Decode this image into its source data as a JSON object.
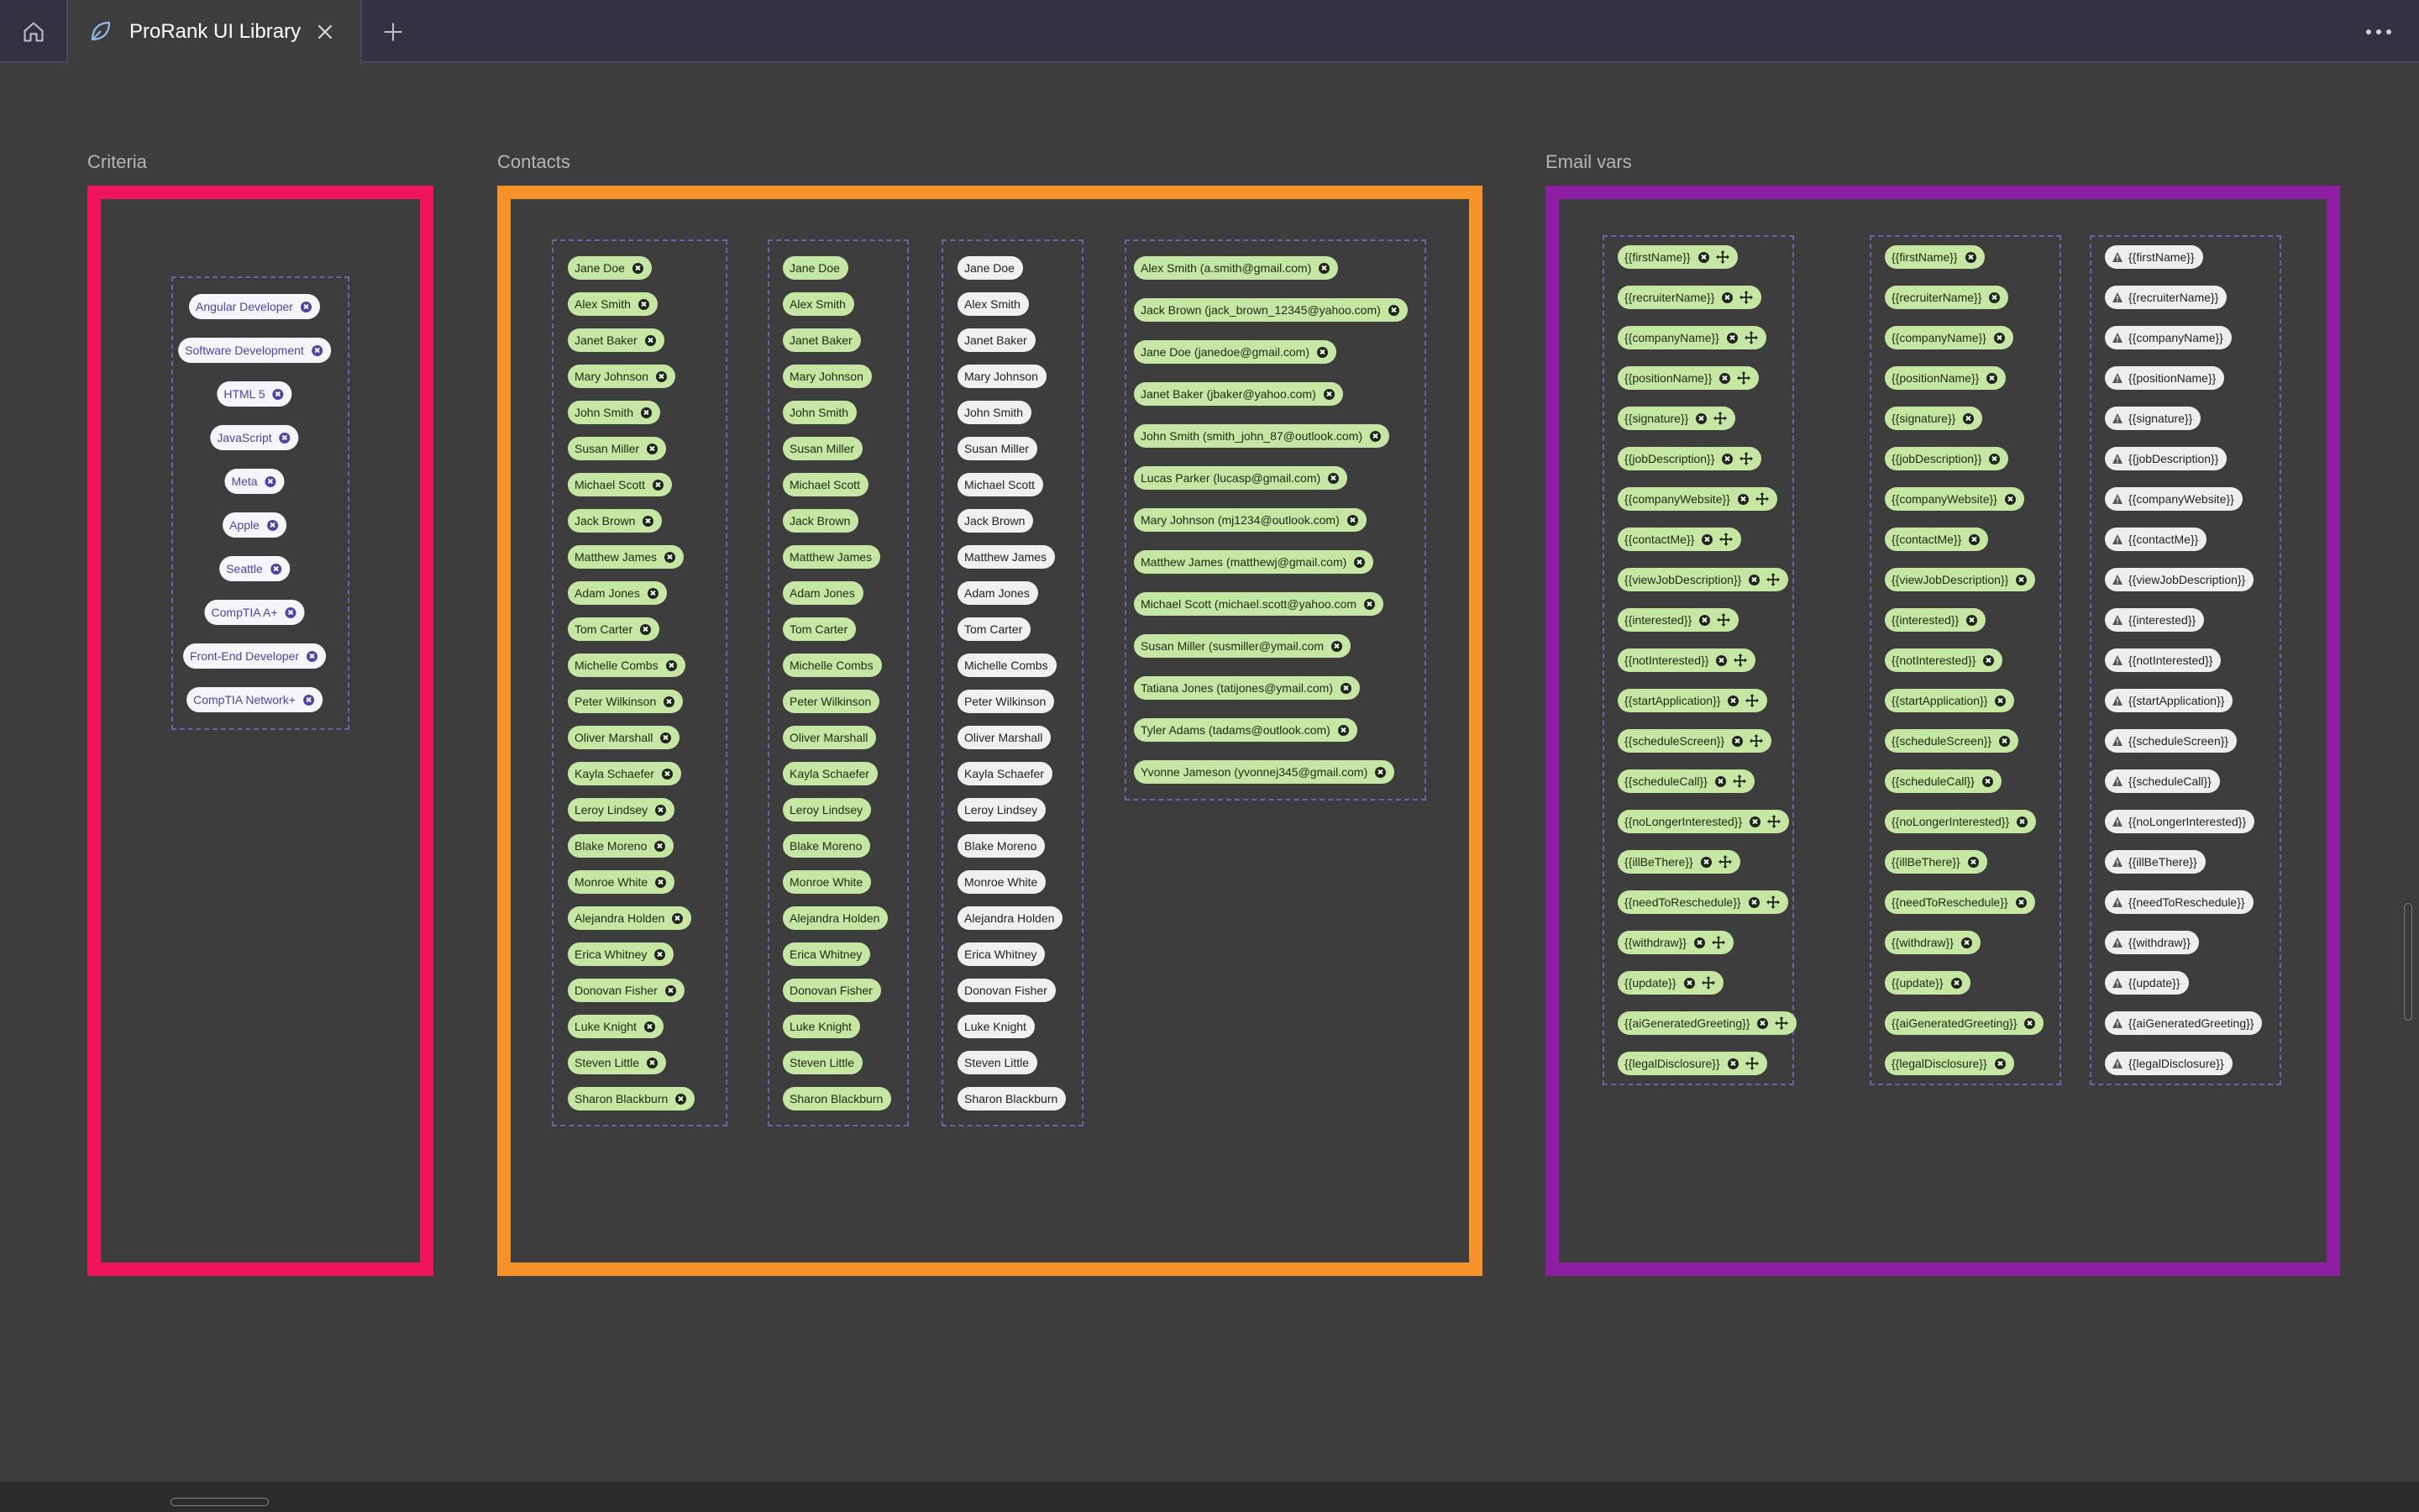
{
  "window": {
    "tab_title": "ProRank UI Library"
  },
  "sections": {
    "criteria_label": "Criteria",
    "contacts_label": "Contacts",
    "email_vars_label": "Email vars"
  },
  "colors": {
    "criteria_border": "#f0145a",
    "contacts_border": "#f7922a",
    "email_border": "#8e1fa3",
    "green_chip": "#c6e7a4",
    "criteria_chip_text": "#4b46a6"
  },
  "criteria": [
    "Angular Developer",
    "Software Development",
    "HTML 5",
    "JavaScript",
    "Meta",
    "Apple",
    "Seattle",
    "CompTIA A+",
    "Front-End Developer",
    "CompTIA Network+"
  ],
  "contacts_names": [
    "Jane Doe",
    "Alex Smith",
    "Janet Baker",
    "Mary Johnson",
    "John Smith",
    "Susan Miller",
    "Michael Scott",
    "Jack Brown",
    "Matthew James",
    "Adam Jones",
    "Tom Carter",
    "Michelle Combs",
    "Peter Wilkinson",
    "Oliver Marshall",
    "Kayla Schaefer",
    "Leroy Lindsey",
    "Blake Moreno",
    "Monroe White",
    "Alejandra Holden",
    "Erica Whitney",
    "Donovan Fisher",
    "Luke Knight",
    "Steven Little",
    "Sharon Blackburn"
  ],
  "contacts_emails": [
    "Alex Smith (a.smith@gmail.com)",
    "Jack Brown (jack_brown_12345@yahoo.com)",
    "Jane Doe (janedoe@gmail.com)",
    "Janet Baker (jbaker@yahoo.com)",
    "John Smith (smith_john_87@outlook.com)",
    "Lucas Parker (lucasp@gmail.com)",
    "Mary Johnson (mj1234@outlook.com)",
    "Matthew James (matthewj@gmail.com)",
    "Michael Scott (michael.scott@yahoo.com",
    "Susan Miller (susmiller@ymail.com",
    "Tatiana Jones (tatijones@ymail.com)",
    "Tyler Adams (tadams@outlook.com)",
    "Yvonne Jameson (yvonnej345@gmail.com)"
  ],
  "email_vars": [
    "{{firstName}}",
    "{{recruiterName}}",
    "{{companyName}}",
    "{{positionName}}",
    "{{signature}}",
    "{{jobDescription}}",
    "{{companyWebsite}}",
    "{{contactMe}}",
    "{{viewJobDescription}}",
    "{{interested}}",
    "{{notInterested}}",
    "{{startApplication}}",
    "{{scheduleScreen}}",
    "{{scheduleCall}}",
    "{{noLongerInterested}}",
    "{{illBeThere}}",
    "{{needToReschedule}}",
    "{{withdraw}}",
    "{{update}}",
    "{{aiGeneratedGreeting}}",
    "{{legalDisclosure}}"
  ],
  "icons": {
    "home": "home-icon",
    "tab": "leaf-icon",
    "close": "close-icon",
    "add": "plus-icon",
    "more": "more-horizontal-icon",
    "chip_remove": "remove-circle-icon",
    "chip_move": "move-icon",
    "chip_warning": "warning-icon"
  }
}
